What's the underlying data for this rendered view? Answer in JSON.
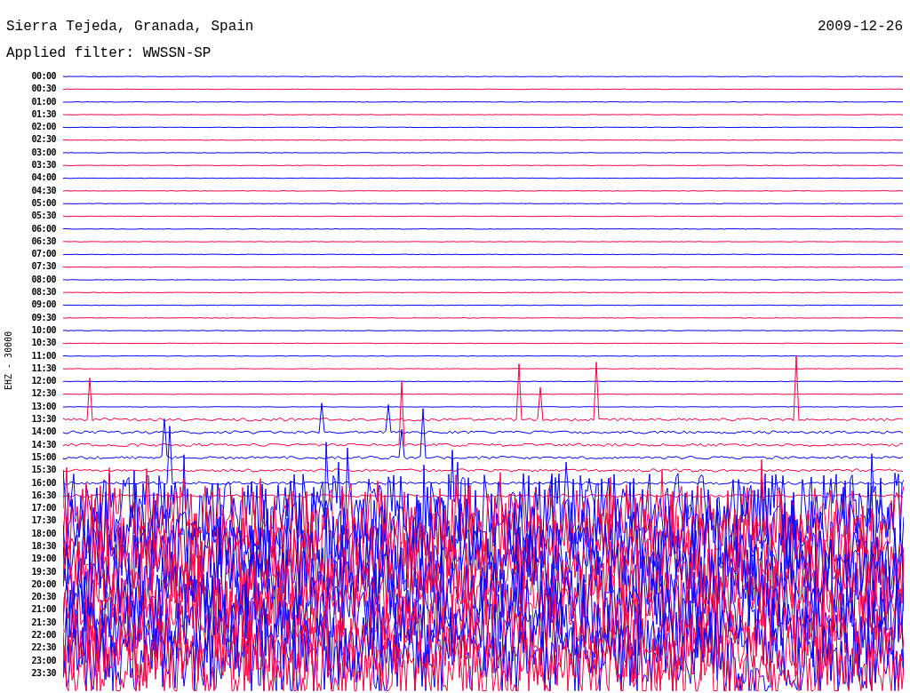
{
  "header": {
    "station": "Sierra Tejeda, Granada, Spain",
    "date": "2009-12-26",
    "filter": "Applied filter: WWSSN-SP"
  },
  "channel_label": "EHZ - 30000",
  "rows": [
    {
      "label": "00:00"
    },
    {
      "label": "00:30"
    },
    {
      "label": "01:00"
    },
    {
      "label": "01:30"
    },
    {
      "label": "02:00"
    },
    {
      "label": "02:30"
    },
    {
      "label": "03:00"
    },
    {
      "label": "03:30"
    },
    {
      "label": "04:00"
    },
    {
      "label": "04:30"
    },
    {
      "label": "05:00"
    },
    {
      "label": "05:30"
    },
    {
      "label": "06:00"
    },
    {
      "label": "06:30"
    },
    {
      "label": "07:00"
    },
    {
      "label": "07:30"
    },
    {
      "label": "08:00"
    },
    {
      "label": "08:30"
    },
    {
      "label": "09:00"
    },
    {
      "label": "09:30"
    },
    {
      "label": "10:00"
    },
    {
      "label": "10:30"
    },
    {
      "label": "11:00"
    },
    {
      "label": "11:30"
    },
    {
      "label": "12:00"
    },
    {
      "label": "12:30"
    },
    {
      "label": "13:00"
    },
    {
      "label": "13:30"
    },
    {
      "label": "14:00"
    },
    {
      "label": "14:30"
    },
    {
      "label": "15:00"
    },
    {
      "label": "15:30"
    },
    {
      "label": "16:00"
    },
    {
      "label": "16:30"
    },
    {
      "label": "17:00"
    },
    {
      "label": "17:30"
    },
    {
      "label": "18:00"
    },
    {
      "label": "18:30"
    },
    {
      "label": "19:00"
    },
    {
      "label": "19:30"
    },
    {
      "label": "20:00"
    },
    {
      "label": "20:30"
    },
    {
      "label": "21:00"
    },
    {
      "label": "21:30"
    },
    {
      "label": "22:00"
    },
    {
      "label": "22:30"
    },
    {
      "label": "23:00"
    },
    {
      "label": "23:30"
    }
  ]
}
